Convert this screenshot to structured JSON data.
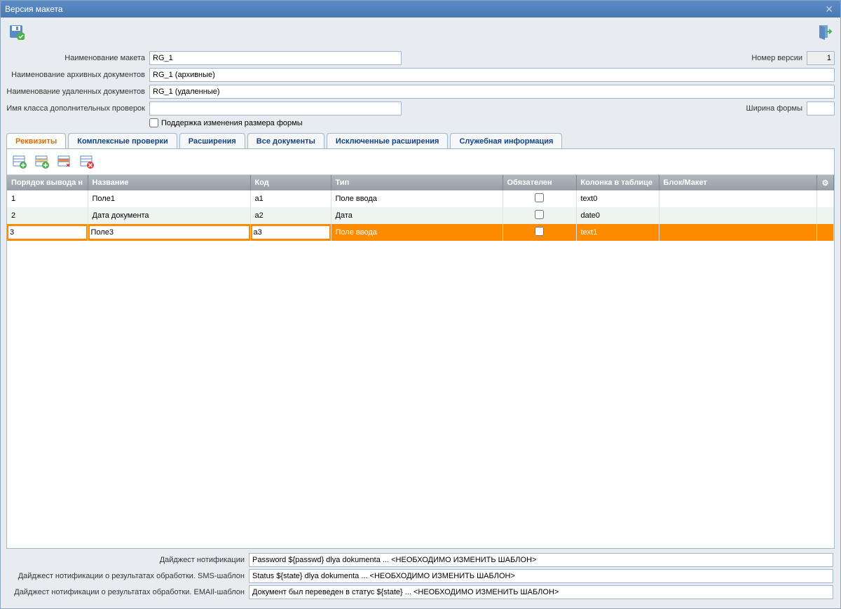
{
  "window": {
    "title": "Версия макета"
  },
  "form": {
    "name_label": "Наименование макета",
    "name_value": "RG_1",
    "version_label": "Номер версии",
    "version_value": "1",
    "archive_label": "Наименование архивных документов",
    "archive_value": "RG_1 (архивные)",
    "deleted_label": "Наименование удаленных документов",
    "deleted_value": "RG_1 (удаленные)",
    "class_label": "Имя класса дополнительных проверок",
    "class_value": "",
    "width_label": "Ширина формы",
    "width_value": "",
    "resize_label": "Поддержка изменения размера формы"
  },
  "tabs": [
    {
      "label": "Реквизиты",
      "active": true
    },
    {
      "label": "Комплексные проверки"
    },
    {
      "label": "Расширения"
    },
    {
      "label": "Все документы"
    },
    {
      "label": "Исключенные расширения"
    },
    {
      "label": "Служебная информация"
    }
  ],
  "table": {
    "columns": [
      "Порядок вывода н",
      "Название",
      "Код",
      "Тип",
      "Обязателен",
      "Колонка в таблице",
      "Блок/Макет"
    ],
    "rows": [
      {
        "order": "1",
        "name": "Поле1",
        "code": "a1",
        "type": "Поле ввода",
        "col": "text0",
        "req": false
      },
      {
        "order": "2",
        "name": "Дата документа",
        "code": "a2",
        "type": "Дата",
        "col": "date0",
        "req": false
      },
      {
        "order": "3",
        "name": "Поле3",
        "code": "a3",
        "type": "Поле ввода",
        "col": "text1",
        "req": false,
        "selected": true
      }
    ]
  },
  "bottom": {
    "digest_label": "Дайджест нотификации",
    "digest_value": "Password ${passwd} dlya dokumenta ... <НЕОБХОДИМО ИЗМЕНИТЬ ШАБЛОН>",
    "sms_label": "Дайджест нотификации о результатах обработки. SMS-шаблон",
    "sms_value": "Status ${state} dlya dokumenta ... <НЕОБХОДИМО ИЗМЕНИТЬ ШАБЛОН>",
    "email_label": "Дайджест нотификации о результатах обработки. EMAIl-шаблон",
    "email_value": "Документ был переведен в статус ${state} ... <НЕОБХОДИМО ИЗМЕНИТЬ ШАБЛОН>"
  }
}
